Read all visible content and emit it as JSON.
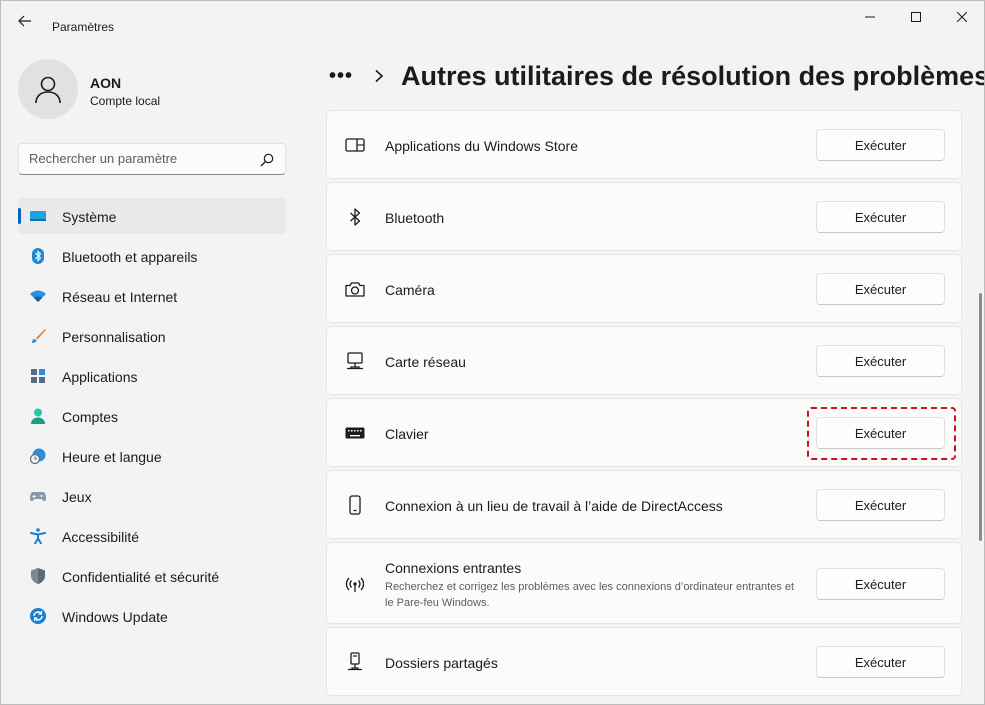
{
  "window": {
    "title": "Paramètres"
  },
  "profile": {
    "name": "AON",
    "account_type": "Compte local"
  },
  "search": {
    "placeholder": "Rechercher un paramètre"
  },
  "nav": {
    "items": [
      {
        "label": "Système",
        "icon": "system-icon",
        "active": true
      },
      {
        "label": "Bluetooth et appareils",
        "icon": "bluetooth-icon"
      },
      {
        "label": "Réseau et Internet",
        "icon": "wifi-icon"
      },
      {
        "label": "Personnalisation",
        "icon": "brush-icon"
      },
      {
        "label": "Applications",
        "icon": "apps-icon"
      },
      {
        "label": "Comptes",
        "icon": "accounts-icon"
      },
      {
        "label": "Heure et langue",
        "icon": "clock-globe-icon"
      },
      {
        "label": "Jeux",
        "icon": "gamepad-icon"
      },
      {
        "label": "Accessibilité",
        "icon": "accessibility-icon"
      },
      {
        "label": "Confidentialité et sécurité",
        "icon": "shield-icon"
      },
      {
        "label": "Windows Update",
        "icon": "update-icon"
      }
    ]
  },
  "breadcrumb": {
    "overflow": "•••",
    "title": "Autres utilitaires de résolution des problèmes"
  },
  "troubleshooters": [
    {
      "title": "Applications du Windows Store",
      "icon": "store-app-icon",
      "button": "Exécuter"
    },
    {
      "title": "Bluetooth",
      "icon": "bluetooth-icon",
      "button": "Exécuter"
    },
    {
      "title": "Caméra",
      "icon": "camera-icon",
      "button": "Exécuter"
    },
    {
      "title": "Carte réseau",
      "icon": "network-adapter-icon",
      "button": "Exécuter"
    },
    {
      "title": "Clavier",
      "icon": "keyboard-icon",
      "button": "Exécuter",
      "highlighted": true
    },
    {
      "title": "Connexion à un lieu de travail à l’aide de DirectAccess",
      "icon": "phone-icon",
      "button": "Exécuter"
    },
    {
      "title": "Connexions entrantes",
      "description": "Recherchez et corrigez les problèmes avec les connexions d’ordinateur entrantes et le Pare-feu Windows.",
      "icon": "incoming-connection-icon",
      "button": "Exécuter"
    },
    {
      "title": "Dossiers partagés",
      "icon": "shared-folder-icon",
      "button": "Exécuter"
    }
  ],
  "colors": {
    "accent": "#0067c0",
    "highlight": "#d0101e",
    "background": "#f3f3f3",
    "card": "#fbfbfb"
  }
}
